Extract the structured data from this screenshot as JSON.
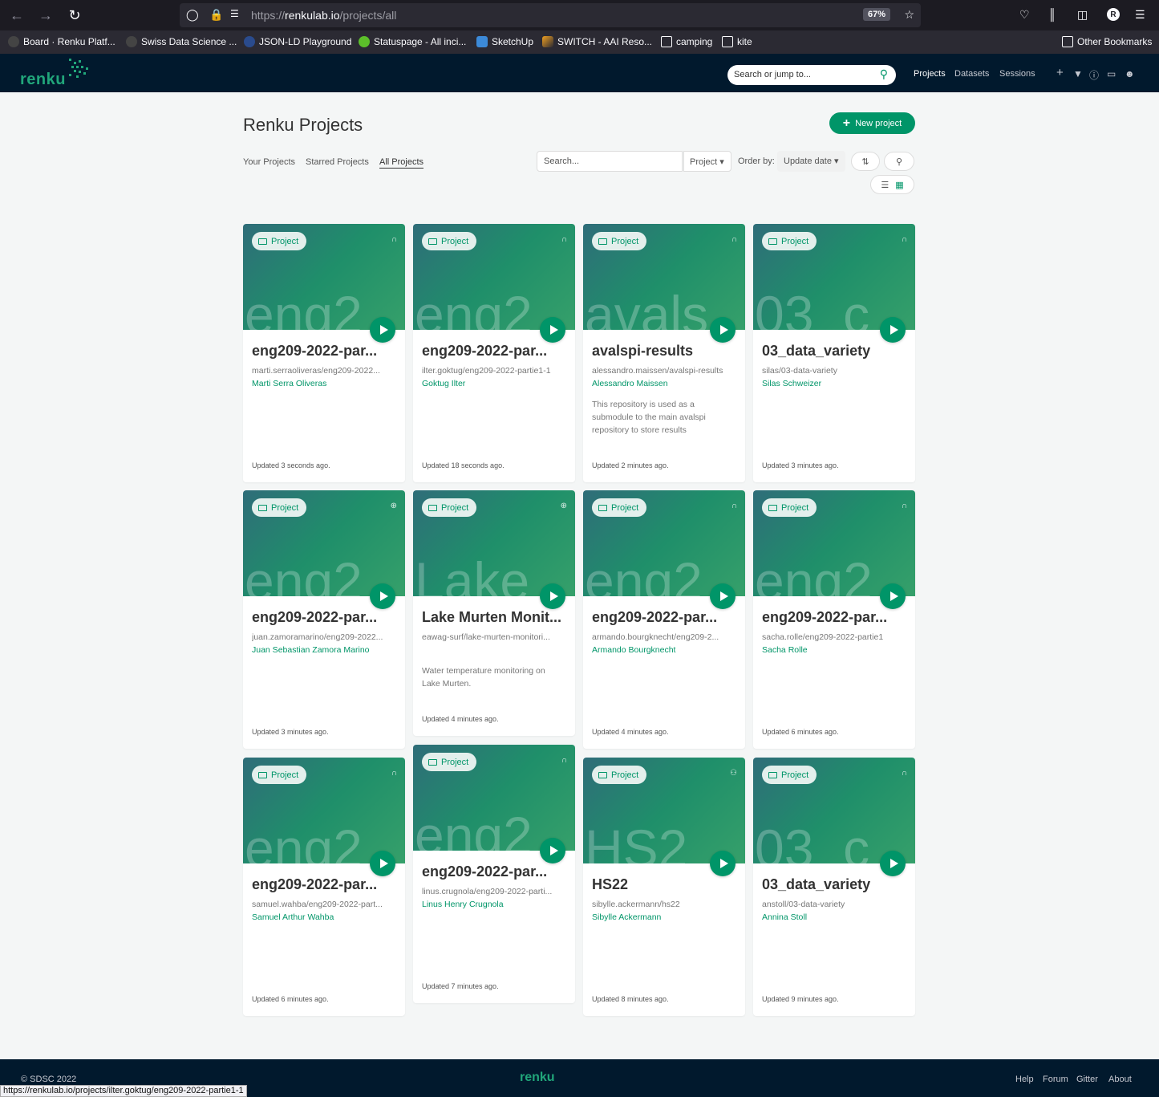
{
  "browser": {
    "url_prefix": "https://",
    "url_host": "renkulab.io",
    "url_path": "/projects/all",
    "zoom": "67%",
    "avatar_letter": "R",
    "bookmarks": [
      {
        "label": "Board · Renku Platf...",
        "icon": "github-icon"
      },
      {
        "label": "Swiss Data Science ...",
        "icon": "github-icon"
      },
      {
        "label": "JSON-LD Playground",
        "icon": "jsonld-icon"
      },
      {
        "label": "Statuspage - All inci...",
        "icon": "statuspage-icon"
      },
      {
        "label": "SketchUp",
        "icon": "sketchup-icon"
      },
      {
        "label": "SWITCH - AAI Reso...",
        "icon": "switch-icon"
      },
      {
        "label": "camping",
        "icon": "folder-icon"
      },
      {
        "label": "kite",
        "icon": "folder-icon"
      }
    ],
    "other_bookmarks": "Other Bookmarks",
    "status_url": "https://renkulab.io/projects/ilter.goktug/eng209-2022-partie1-1"
  },
  "header": {
    "logo": "renku",
    "search_placeholder": "Search or jump to...",
    "nav": [
      "Projects",
      "Datasets",
      "Sessions"
    ]
  },
  "main": {
    "title": "Renku Projects",
    "new_project": "New project",
    "tabs": [
      "Your Projects",
      "Starred Projects",
      "All Projects"
    ],
    "search_placeholder": "Search...",
    "search_in": "Project",
    "order_by_label": "Order by:",
    "order_by": "Update date"
  },
  "cards": [
    {
      "badge": "Project",
      "banner": "eng2",
      "title": "eng209-2022-par...",
      "path": "marti.serraoliveras/eng209-2022...",
      "owner": "Marti Serra Oliveras",
      "desc": "",
      "updated": "Updated 3 seconds ago.",
      "vis_icon": "lock-icon"
    },
    {
      "badge": "Project",
      "banner": "eng2",
      "title": "eng209-2022-par...",
      "path": "ilter.goktug/eng209-2022-partie1-1",
      "owner": "Goktug Ilter",
      "desc": "",
      "updated": "Updated 18 seconds ago.",
      "vis_icon": "lock-icon"
    },
    {
      "badge": "Project",
      "banner": "avals",
      "title": "avalspi-results",
      "path": "alessandro.maissen/avalspi-results",
      "owner": "Alessandro Maissen",
      "desc": "This repository is used as a submodule to the main avalspi repository to store results",
      "updated": "Updated 2 minutes ago.",
      "vis_icon": "lock-icon"
    },
    {
      "badge": "Project",
      "banner": "03_c",
      "title": "03_data_variety",
      "path": "silas/03-data-variety",
      "owner": "Silas Schweizer",
      "desc": "",
      "updated": "Updated 3 minutes ago.",
      "vis_icon": "lock-icon"
    },
    {
      "badge": "Project",
      "banner": "eng2",
      "title": "eng209-2022-par...",
      "path": "juan.zamoramarino/eng209-2022...",
      "owner": "Juan Sebastian Zamora Marino",
      "desc": "",
      "updated": "Updated 3 minutes ago.",
      "vis_icon": "globe-icon"
    },
    {
      "badge": "Project",
      "banner": "Lake",
      "title": "Lake Murten Monit...",
      "path": "eawag-surf/lake-murten-monitori...",
      "owner": "",
      "desc": "Water temperature monitoring on Lake Murten.",
      "updated": "Updated 4 minutes ago.",
      "vis_icon": "globe-icon"
    },
    {
      "badge": "Project",
      "banner": "eng2",
      "title": "eng209-2022-par...",
      "path": "armando.bourgknecht/eng209-2...",
      "owner": "Armando Bourgknecht",
      "desc": "",
      "updated": "Updated 4 minutes ago.",
      "vis_icon": "lock-icon"
    },
    {
      "badge": "Project",
      "banner": "eng2",
      "title": "eng209-2022-par...",
      "path": "sacha.rolle/eng209-2022-partie1",
      "owner": "Sacha Rolle",
      "desc": "",
      "updated": "Updated 6 minutes ago.",
      "vis_icon": "lock-icon"
    },
    {
      "badge": "Project",
      "banner": "eng2",
      "title": "eng209-2022-par...",
      "path": "samuel.wahba/eng209-2022-part...",
      "owner": "Samuel Arthur Wahba",
      "desc": "",
      "updated": "Updated 6 minutes ago.",
      "vis_icon": "lock-icon"
    },
    {
      "badge": "Project",
      "banner": "eng2",
      "title": "eng209-2022-par...",
      "path": "linus.crugnola/eng209-2022-parti...",
      "owner": "Linus Henry Crugnola",
      "desc": "",
      "updated": "Updated 7 minutes ago.",
      "vis_icon": "lock-icon"
    },
    {
      "badge": "Project",
      "banner": "HS2",
      "title": "HS22",
      "path": "sibylle.ackermann/hs22",
      "owner": "Sibylle Ackermann",
      "desc": "",
      "updated": "Updated 8 minutes ago.",
      "vis_icon": "group-icon"
    },
    {
      "badge": "Project",
      "banner": "03_c",
      "title": "03_data_variety",
      "path": "anstoll/03-data-variety",
      "owner": "Annina Stoll",
      "desc": "",
      "updated": "Updated 9 minutes ago.",
      "vis_icon": "lock-icon"
    }
  ],
  "footer": {
    "copyright": "© SDSC 2022",
    "logo": "renku",
    "links": [
      "Help",
      "Forum",
      "Gitter",
      "About"
    ]
  }
}
